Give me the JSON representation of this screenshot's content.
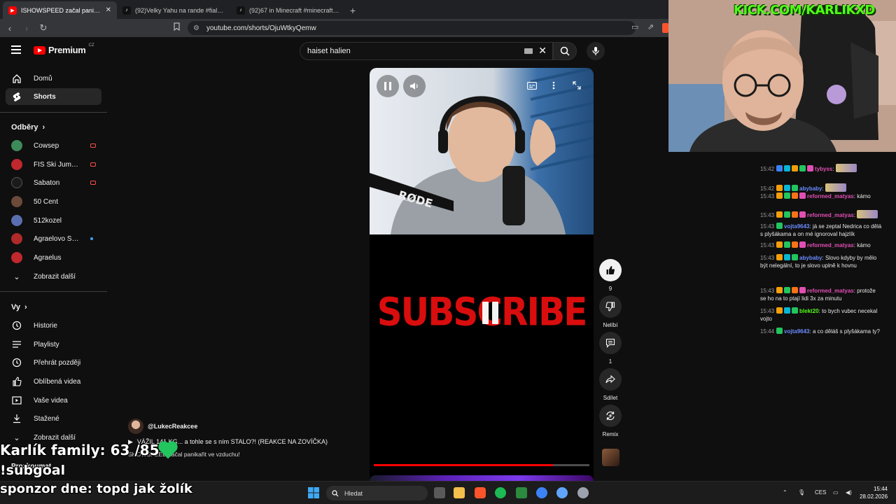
{
  "browser": {
    "tabs": [
      {
        "title": "ISHOWSPEED začal panikařit",
        "active": true
      },
      {
        "title": "(92)Velky Yahu na rande #fialafeetpic",
        "active": false
      },
      {
        "title": "(92)67 in Minecraft #minecraft #mine",
        "active": false
      }
    ],
    "url": "youtube.com/shorts/OjuWtkyQemw"
  },
  "youtube": {
    "logo_text": "Premium",
    "region": "CZ",
    "search_query": "haiset halien",
    "sidebar": {
      "main": [
        {
          "label": "Domů",
          "icon": "home-icon",
          "selected": false
        },
        {
          "label": "Shorts",
          "icon": "shorts-icon",
          "selected": true
        }
      ],
      "subscriptions_header": "Odběry",
      "subscriptions": [
        {
          "label": "Cowsep",
          "color": "#3d8b5a",
          "live": true
        },
        {
          "label": "FIS Ski Jumping",
          "color": "#c0282d",
          "live": true
        },
        {
          "label": "Sabaton",
          "color": "#1b1b1b",
          "live": true
        },
        {
          "label": "50 Cent",
          "color": "#6b4a3a",
          "live": false
        },
        {
          "label": "512kozel",
          "color": "#5a6fb0",
          "live": false
        },
        {
          "label": "Agraelovo Strea...",
          "color": "#b02a2a",
          "live": false,
          "new": true
        },
        {
          "label": "Agraelus",
          "color": "#c0282d",
          "live": false
        }
      ],
      "show_more": "Zobrazit další",
      "you_header": "Vy",
      "you_items": [
        {
          "label": "Historie",
          "icon": "history-icon"
        },
        {
          "label": "Playlisty",
          "icon": "playlists-icon"
        },
        {
          "label": "Přehrát později",
          "icon": "watch-later-icon"
        },
        {
          "label": "Oblíbená videa",
          "icon": "liked-icon"
        },
        {
          "label": "Vaše videa",
          "icon": "your-videos-icon"
        },
        {
          "label": "Stažené",
          "icon": "downloads-icon"
        },
        {
          "label": "Zobrazit další",
          "icon": "chevron-down-icon"
        }
      ],
      "explore_header": "Prozkoumat"
    },
    "short": {
      "subscribe_text": "SUBSCRIBE",
      "progress": 0.83,
      "channel": "@LukecReakcee",
      "title": "VÁŽIL 141 KG... a tohle se s ním STALO?! (REAKCE NA ZOVÍČKA)",
      "subtitle": "SHOWSPEED začal panikařit ve vzduchu!",
      "actions": {
        "like_count": "9",
        "dislike_label": "Nelíbí",
        "comment_count": "1",
        "share_label": "Sdílet",
        "remix_label": "Remix"
      }
    }
  },
  "overlay": {
    "family_text": "Karlík family: 63 /85",
    "subgoal_text": "!subgoal",
    "sponsor_text": "sponzor dne: topd jak žolík"
  },
  "stream": {
    "kick_url": "KICK.COM/KARLIKXD",
    "chat": [
      {
        "time": "15:42",
        "user": "tybyss",
        "text": "",
        "color": "#e14fb4",
        "badges": [
          "#3b82f6",
          "#06b6d4",
          "#f59e0b",
          "#22c55e",
          "#e14fb4"
        ],
        "emote": true
      },
      {
        "time": "15:42",
        "user": "abybaby",
        "text": "",
        "color": "#6b8cff",
        "badges": [
          "#f59e0b",
          "#06b6d4",
          "#22c55e"
        ],
        "emote": true
      },
      {
        "time": "15:43",
        "user": "reformed_matyas",
        "text": "kámo",
        "color": "#e14fb4",
        "badges": [
          "#f59e0b",
          "#22c55e",
          "#f97316",
          "#e14fb4"
        ],
        "emote": false
      },
      {
        "time": "15:43",
        "user": "reformed_matyas",
        "text": "",
        "color": "#e14fb4",
        "badges": [
          "#f59e0b",
          "#22c55e",
          "#f97316",
          "#e14fb4"
        ],
        "emote": true
      },
      {
        "time": "15:43",
        "user": "vojta9643",
        "text": "já se zeptal Nedrica co dělá s plyšákama a on mé ignoroval hajzlík",
        "color": "#6b8cff",
        "badges": [
          "#22c55e"
        ],
        "emote": false
      },
      {
        "time": "15:43",
        "user": "reformed_matyas",
        "text": "kámo",
        "color": "#e14fb4",
        "badges": [
          "#f59e0b",
          "#22c55e",
          "#f97316",
          "#e14fb4"
        ],
        "emote": false
      },
      {
        "time": "15:43",
        "user": "abybaby",
        "text": "Slovo kdyby by mělo být nelegální, to je slovo uplně k hovnu",
        "color": "#6b8cff",
        "badges": [
          "#f59e0b",
          "#06b6d4",
          "#22c55e"
        ],
        "emote": false
      },
      {
        "time": "15:43",
        "user": "reformed_matyas",
        "text": "protože se ho na to ptají lidi 3x za minutu",
        "color": "#e14fb4",
        "badges": [
          "#f59e0b",
          "#22c55e",
          "#f97316",
          "#e14fb4"
        ],
        "emote": false
      },
      {
        "time": "15:43",
        "user": "blekt20",
        "text": "to bych vubec necekal vojto",
        "color": "#53fc18",
        "badges": [
          "#f59e0b",
          "#06b6d4",
          "#22c55e"
        ],
        "emote": false
      },
      {
        "time": "15:44",
        "user": "vojta9643",
        "text": "a co děláš s plyšákama ty?",
        "color": "#6b8cff",
        "badges": [
          "#22c55e"
        ],
        "emote": false
      }
    ]
  },
  "taskbar": {
    "search_label": "Hledat",
    "lang": "CES",
    "time": "15:44",
    "date": "28.02.2026"
  }
}
